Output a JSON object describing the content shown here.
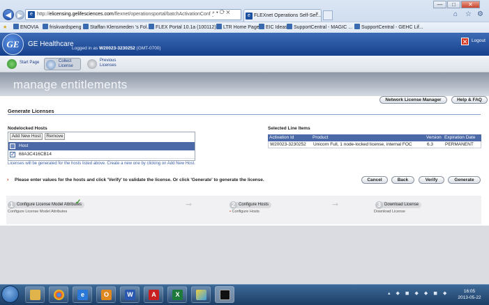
{
  "browser": {
    "url_domain": "elicensing.gelifesciences.com",
    "url_prefix": "http://",
    "url_path": "/flexnet/operationsportal/batchActivationConfig",
    "addr_controls": "⌕ ▾ ⟳ ✕",
    "tab_title": "FLEXnet Operations Self-Ser...",
    "tab_close": "×",
    "window_controls": {
      "minimize": "—",
      "maximize": "□",
      "close": "✕"
    },
    "toolbar_icons": [
      "home-icon",
      "star-icon",
      "gear-icon"
    ],
    "bookmarks": [
      "ENOVIA",
      "friskvardspeng",
      "Staffan Klensmeden 's Fol...",
      "FLEX Portal 10.1a (100112)...",
      "LTR Home Page",
      "EIC Ideas",
      "SupportCentral - MAGIC ...",
      "SupportCentral - GEHC Lif..."
    ]
  },
  "header": {
    "logo_text": "GE",
    "brand": "GE Healthcare",
    "logged_in_prefix": "Logged in as",
    "user": "W20023-3230252",
    "timezone": "(GMT-0700)",
    "logout": "Logout"
  },
  "subnav": [
    {
      "label1": "Start Page",
      "label2": ""
    },
    {
      "label1": "Collect",
      "label2": "License"
    },
    {
      "label1": "Previous",
      "label2": "Licenses"
    }
  ],
  "banner_title": "manage entitlements",
  "buttons_top": {
    "nlm": "Network License Manager",
    "help": "Help & FAQ"
  },
  "section_title": "Generate Licenses",
  "hosts": {
    "title": "Nodelocked Hosts",
    "add_btn": "Add New Host",
    "remove_btn": "Remove",
    "col_header": "Host",
    "rows": [
      {
        "checked": true,
        "value": "68A3C416CB14"
      }
    ],
    "note": "Licenses will be generated for the hosts listed above. Create a new one by clicking on Add New Host."
  },
  "line_items": {
    "title": "Selected Line Items",
    "columns": [
      "Activation Id",
      "Product",
      "Version",
      "Expiration Date"
    ],
    "rows": [
      [
        "W20023-3230252",
        "Unicorn Full, 1 node-locked license, internal FOC",
        "6.3",
        "PERMANENT"
      ]
    ]
  },
  "instruction": "Please enter values for the hosts and click 'Verify' to validate the license. Or click 'Generate' to generate the license.",
  "actions": {
    "cancel": "Cancel",
    "back": "Back",
    "verify": "Verify",
    "generate": "Generate"
  },
  "steps": [
    {
      "num": "1",
      "label": "Configure License Model Attributes",
      "sub": "Configure License Model Attributes",
      "done": true
    },
    {
      "num": "2",
      "label": "Configure Hosts",
      "sub": "Configure Hosts",
      "active": true
    },
    {
      "num": "3",
      "label": "Download License",
      "sub": "Download License"
    }
  ],
  "step_check": "✓",
  "step_arrow": "➞",
  "taskbar": {
    "apps": [
      "explorer-icon",
      "chrome-icon",
      "ie-icon",
      "outlook-icon",
      "word-icon",
      "pdf-icon",
      "excel-icon",
      "paint-icon",
      "cmd-icon"
    ],
    "app_letters": [
      "",
      "",
      "e",
      "O",
      "W",
      "A",
      "X",
      "",
      ""
    ],
    "time": "16:05",
    "date": "2013-05-22"
  },
  "colors": {
    "ge_blue": "#1b4b9c",
    "table_header": "#4a69a6",
    "error_red": "#c8321c"
  }
}
